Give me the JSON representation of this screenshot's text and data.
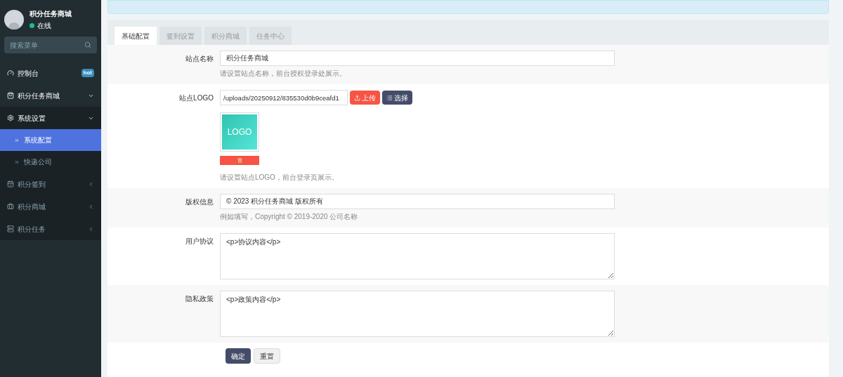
{
  "sidebar": {
    "user": {
      "name": "积分任务商城",
      "status": "在线",
      "online": true
    },
    "search": {
      "placeholder": "搜索菜单"
    },
    "items": [
      {
        "label": "控制台",
        "badge": "hot"
      },
      {
        "label": "积分任务商城",
        "expanded": true
      },
      {
        "label": "系统设置",
        "expanded": true,
        "children": [
          {
            "label": "系统配置",
            "selected": true
          },
          {
            "label": "快递公司",
            "selected": false
          }
        ]
      },
      {
        "label": "积分签到",
        "expanded": false
      },
      {
        "label": "积分商城",
        "expanded": false
      },
      {
        "label": "积分任务",
        "expanded": false
      }
    ]
  },
  "tabs": [
    {
      "label": "基础配置",
      "selected": true
    },
    {
      "label": "签到设置",
      "selected": false
    },
    {
      "label": "积分商城",
      "selected": false
    },
    {
      "label": "任务中心",
      "selected": false
    }
  ],
  "fields": [
    {
      "kind": "text",
      "label": "站点名称",
      "value": "积分任务商城",
      "help": "请设置站点名称，前台授权登录处展示。"
    },
    {
      "kind": "image",
      "label": "站点LOGO",
      "value": "/uploads/20250912/835530d0b9ceafd1",
      "upload": "上传",
      "choose": "选择",
      "preview": "LOGO",
      "help": "请设置站点LOGO，前台登录页展示。"
    },
    {
      "kind": "text",
      "label": "版权信息",
      "value": "© 2023 积分任务商城 版权所有",
      "help": "例如填写，Copyright © 2019-2020 公司名称"
    },
    {
      "kind": "textarea",
      "label": "用户协议",
      "value": "<p>协议内容</p>"
    },
    {
      "kind": "textarea",
      "label": "隐私政策",
      "value": "<p>政策内容</p>"
    }
  ],
  "actions": {
    "submit": "确定",
    "reset": "重置"
  }
}
